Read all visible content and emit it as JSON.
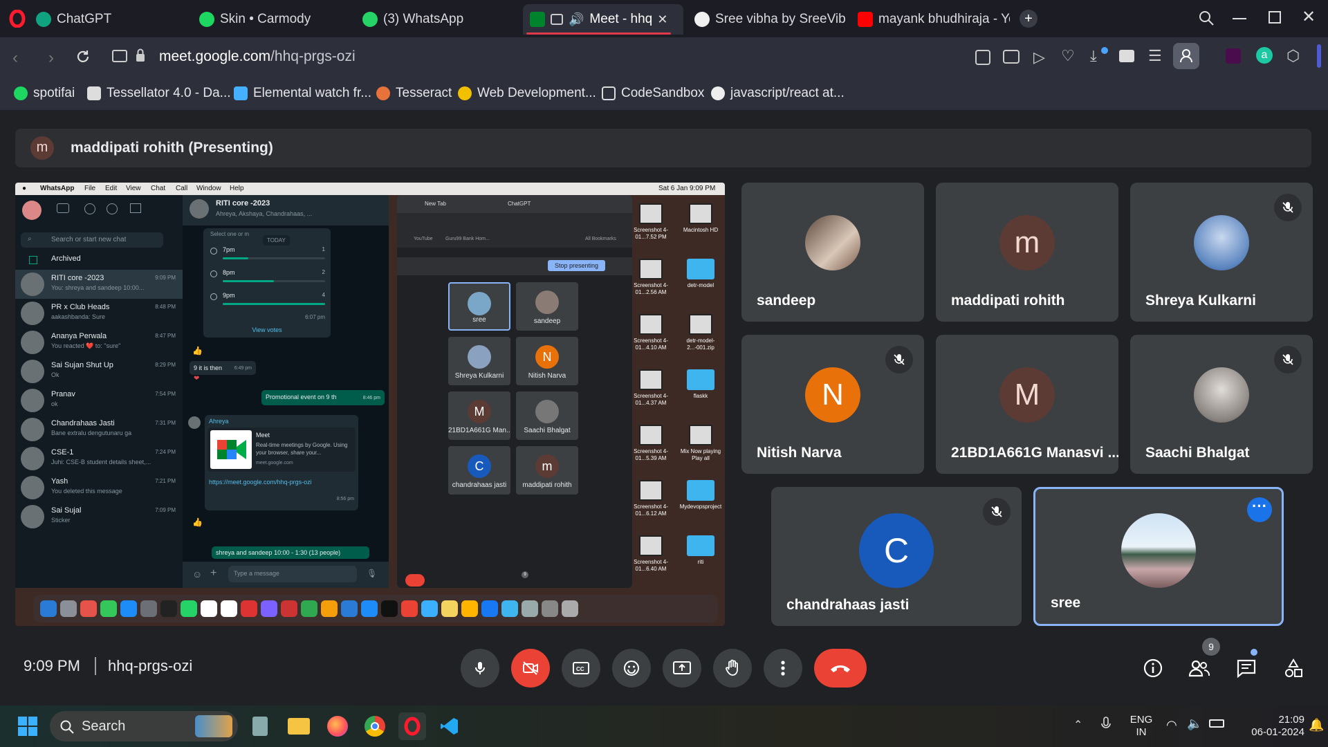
{
  "browser": {
    "tabs": [
      {
        "label": "ChatGPT"
      },
      {
        "label": "Skin • Carmody"
      },
      {
        "label": "(3) WhatsApp"
      },
      {
        "label": "Meet - hhq-p"
      },
      {
        "label": "Sree vibha by SreeVibha"
      },
      {
        "label": "mayank bhudhiraja - Yo"
      }
    ],
    "url_host": "meet.google.com",
    "url_path": "/hhq-prgs-ozi",
    "bookmarks": [
      {
        "label": "spotifai"
      },
      {
        "label": "Tessellator 4.0 - Da..."
      },
      {
        "label": "Elemental watch fr..."
      },
      {
        "label": "Tesseract"
      },
      {
        "label": "Web Development..."
      },
      {
        "label": "CodeSandbox"
      },
      {
        "label": "javascript/react at..."
      }
    ]
  },
  "meet": {
    "presenter_initial": "m",
    "presenter_label": "maddipati rohith (Presenting)",
    "participants": [
      {
        "name": "sandeep",
        "initial": ""
      },
      {
        "name": "maddipati rohith",
        "initial": "m"
      },
      {
        "name": "Shreya Kulkarni",
        "initial": ""
      },
      {
        "name": "Nitish Narva",
        "initial": "N"
      },
      {
        "name": "21BD1A661G Manasvi ...",
        "initial": "M"
      },
      {
        "name": "Saachi Bhalgat",
        "initial": ""
      },
      {
        "name": "chandrahaas jasti",
        "initial": "C"
      },
      {
        "name": "sree",
        "initial": ""
      }
    ],
    "time": "9:09 PM",
    "meeting_code": "hhq-prgs-ozi",
    "people_count": "9"
  },
  "shared_screen": {
    "menubar": {
      "app": "WhatsApp",
      "items": [
        "File",
        "Edit",
        "View",
        "Chat",
        "Call",
        "Window",
        "Help"
      ],
      "clock": "Sat 6 Jan  9:09 PM"
    },
    "search_placeholder": "Search or start new chat",
    "archived": "Archived",
    "chats": [
      {
        "name": "RITI core -2023",
        "msg": "You: shreya and sandeep 10:00...",
        "time": "9:09 PM"
      },
      {
        "name": "PR x Club Heads",
        "msg": "aakashbanda: Sure",
        "time": "8:48 PM"
      },
      {
        "name": "Ananya Perwala",
        "msg": "You reacted ❤️ to: \"sure\"",
        "time": "8:47 PM"
      },
      {
        "name": "Sai Sujan Shut Up",
        "msg": "Ok",
        "time": "8:29 PM"
      },
      {
        "name": "Pranav",
        "msg": "ok",
        "time": "7:54 PM"
      },
      {
        "name": "Chandrahaas Jasti",
        "msg": "Bane extralu dengutunaru ga",
        "time": "7:31 PM"
      },
      {
        "name": "CSE-1",
        "msg": "Juhi: CSE-B student details sheet,...",
        "time": "7:24 PM"
      },
      {
        "name": "Yash",
        "msg": "You deleted this message",
        "time": "7:21 PM"
      },
      {
        "name": "Sai Sujal",
        "msg": "Sticker",
        "time": "7:09 PM"
      }
    ],
    "group_name": "RITI core -2023",
    "group_members": "Ahreya, Akshaya, Chandrahaas, ...",
    "poll_hint": "Select one or m",
    "today": "TODAY",
    "poll_options": [
      {
        "label": "7pm",
        "count": "1",
        "share": 0.25
      },
      {
        "label": "8pm",
        "count": "2",
        "share": 0.5
      },
      {
        "label": "9pm",
        "count": "4",
        "share": 1.0
      }
    ],
    "poll_time": "6:07 pm",
    "view_votes": "View votes",
    "msg_9": "9 it is then",
    "msg_9_time": "6:49 pm",
    "promo": "Promotional event on 9 th",
    "promo_time": "8:46 pm",
    "sender": "Ahreya",
    "link_card_title": "Meet",
    "link_card_desc": "Real-time meetings by Google. Using your browser, share your...",
    "link_card_domain": "meet.google.com",
    "link_url": "https://meet.google.com/hhq-prgs-ozi",
    "link_time": "8:56 pm",
    "last_msg": "shreya and sandeep 10:00 - 1:30  (13 people)",
    "type_placeholder": "Type a message",
    "chrome_tabs": [
      "New Tab",
      "ChatGPT"
    ],
    "chrome_bookmarks": [
      "YouTube",
      "Guru99 Bank Hom...",
      "All Bookmarks"
    ],
    "stop_presenting": "Stop presenting",
    "mini_tiles": [
      {
        "name": "sree",
        "initial": "",
        "color": "#7aa6c8"
      },
      {
        "name": "sandeep",
        "initial": "",
        "color": "#8a7b74"
      },
      {
        "name": "Shreya Kulkarni",
        "initial": "",
        "color": "#8aa1c0"
      },
      {
        "name": "Nitish Narva",
        "initial": "N",
        "color": "#e8710a"
      },
      {
        "name": "21BD1A661G Man...",
        "initial": "M",
        "color": "#5c3b34"
      },
      {
        "name": "Saachi Bhalgat",
        "initial": "",
        "color": "#777"
      },
      {
        "name": "chandrahaas jasti",
        "initial": "C",
        "color": "#185abc"
      },
      {
        "name": "maddipati rohith",
        "initial": "m",
        "color": "#5c3b34"
      }
    ],
    "mini_people": "9",
    "desktop": [
      {
        "label": "Screenshot 4-01...7.52 PM",
        "folder": false
      },
      {
        "label": "Macintosh HD",
        "folder": false
      },
      {
        "label": "Screenshot 4-01...2.56 AM",
        "folder": false
      },
      {
        "label": "detr-model",
        "folder": true
      },
      {
        "label": "Screenshot 4-01...4.10 AM",
        "folder": false
      },
      {
        "label": "detr-model-2...-001.zip",
        "folder": false
      },
      {
        "label": "Screenshot 4-01...4.37 AM",
        "folder": false
      },
      {
        "label": "flaskk",
        "folder": true
      },
      {
        "label": "Screenshot 4-01...5.39 AM",
        "folder": false
      },
      {
        "label": "Mix Now playing Play all",
        "folder": false
      },
      {
        "label": "Screenshot 4-01...6.12 AM",
        "folder": false
      },
      {
        "label": "Mydevopsproject",
        "folder": true
      },
      {
        "label": "Screenshot 4-01...6.40 AM",
        "folder": false
      },
      {
        "label": "riti",
        "folder": true
      }
    ]
  },
  "taskbar": {
    "search_label": "Search",
    "lang": "ENG",
    "region": "IN",
    "clock_time": "21:09",
    "clock_date": "06-01-2024"
  },
  "colors": {
    "leave_red": "#ea4335",
    "accent_blue": "#8ab4f8",
    "meet_bg": "#202124",
    "tile_bg": "#3c4043"
  }
}
